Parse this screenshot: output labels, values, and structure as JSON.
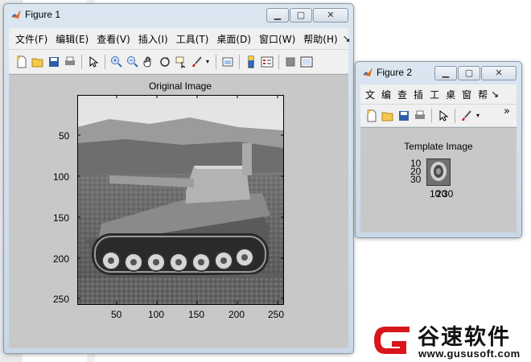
{
  "figure1": {
    "title": "Figure 1",
    "menu": [
      "文件(F)",
      "编辑(E)",
      "查看(V)",
      "插入(I)",
      "工具(T)",
      "桌面(D)",
      "窗口(W)",
      "帮助(H)"
    ],
    "menu_more": "↘",
    "axes_title": "Original Image",
    "yticks": [
      "50",
      "100",
      "150",
      "200",
      "250"
    ],
    "xticks": [
      "50",
      "100",
      "150",
      "200",
      "250"
    ]
  },
  "figure2": {
    "title": "Figure 2",
    "menu": [
      "文",
      "编",
      "查",
      "插",
      "工",
      "桌",
      "窗",
      "帮"
    ],
    "menu_more": "↘",
    "toolbar_more": "»",
    "axes_title": "Template Image",
    "yticks": [
      "10",
      "20",
      "30"
    ],
    "xticks": [
      "10",
      "20",
      "30"
    ]
  },
  "watermark": {
    "brand": "谷速软件",
    "url": "www.gususoft.com"
  },
  "colors": {
    "title_gradient_top": "#dbe6f1",
    "figure_bg": "#c8c8c8",
    "menu_bg": "#f0f0f0",
    "close_red": "#d21f26",
    "logo_red": "#d9161c"
  }
}
